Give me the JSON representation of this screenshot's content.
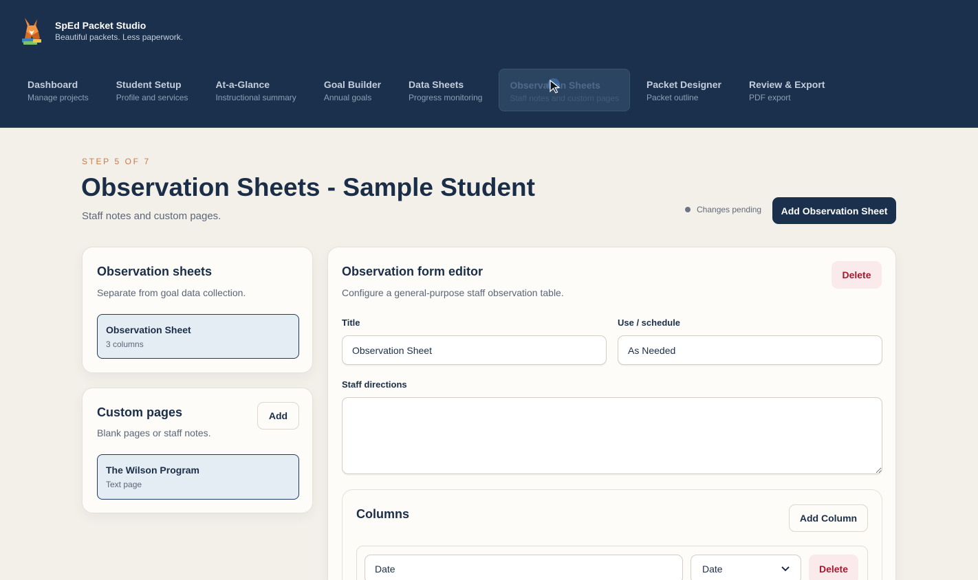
{
  "app": {
    "name": "SpEd Packet Studio",
    "tagline": "Beautiful packets. Less paperwork."
  },
  "nav": [
    {
      "label": "Dashboard",
      "sub": "Manage projects"
    },
    {
      "label": "Student Setup",
      "sub": "Profile and services"
    },
    {
      "label": "At-a-Glance",
      "sub": "Instructional summary"
    },
    {
      "label": "Goal Builder",
      "sub": "Annual goals"
    },
    {
      "label": "Data Sheets",
      "sub": "Progress monitoring"
    },
    {
      "label": "Observation Sheets",
      "sub": "Staff notes and custom pages"
    },
    {
      "label": "Packet Designer",
      "sub": "Packet outline"
    },
    {
      "label": "Review & Export",
      "sub": "PDF export"
    }
  ],
  "page": {
    "step": "STEP 5 OF 7",
    "title": "Observation Sheets - Sample Student",
    "subtitle": "Staff notes and custom pages.",
    "status": "Changes pending",
    "primary_action": "Add Observation Sheet"
  },
  "observation_card": {
    "title": "Observation sheets",
    "desc": "Separate from goal data collection.",
    "item": {
      "title": "Observation Sheet",
      "sub": "3 columns"
    }
  },
  "custom_card": {
    "title": "Custom pages",
    "desc": "Blank pages or staff notes.",
    "add_label": "Add",
    "item": {
      "title": "The Wilson Program",
      "sub": "Text page"
    }
  },
  "editor": {
    "title": "Observation form editor",
    "desc": "Configure a general-purpose staff observation table.",
    "delete_label": "Delete",
    "title_label": "Title",
    "title_value": "Observation Sheet",
    "schedule_label": "Use / schedule",
    "schedule_value": "As Needed",
    "directions_label": "Staff directions",
    "directions_value": ""
  },
  "columns": {
    "title": "Columns",
    "add_label": "Add Column",
    "rows": [
      {
        "name": "Date",
        "type": "Date",
        "delete_label": "Delete"
      }
    ]
  },
  "colors": {
    "header_bg": "#1a304d",
    "accent_step": "#c77a45",
    "danger": "#a11a2c",
    "selected_bg": "#e4edf4"
  }
}
